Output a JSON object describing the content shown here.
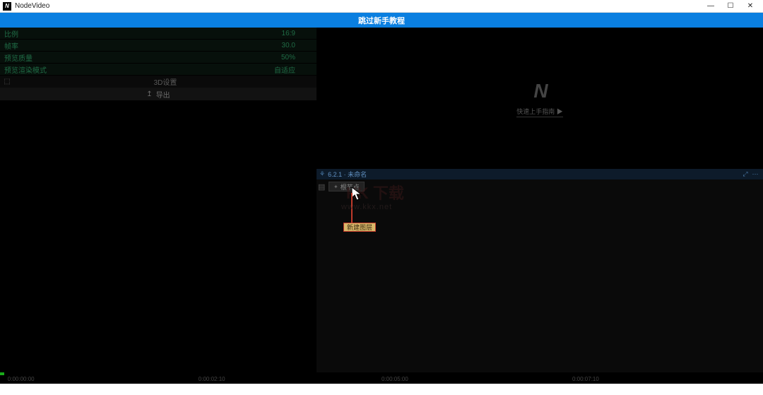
{
  "window": {
    "title": "NodeVideo",
    "logo_glyph": "N"
  },
  "banner": {
    "text": "跳过新手教程"
  },
  "props": {
    "rows": [
      {
        "label": "比例",
        "value": "16:9"
      },
      {
        "label": "帧率",
        "value": "30.0"
      },
      {
        "label": "预览质量",
        "value": "50%"
      },
      {
        "label": "预览渲染模式",
        "value": "自适应"
      }
    ],
    "threed_label": "3D设置",
    "export_label": "导出"
  },
  "preview": {
    "brand_glyph": "N",
    "guide_text": "快速上手指南 ▶"
  },
  "node_panel": {
    "title": "6.2.1 · 未命名",
    "root_node": "根节点",
    "new_layer": "新建图层"
  },
  "watermark": {
    "brand": "KK 下载",
    "url": "www.kkx.net"
  },
  "timeline": {
    "ticks": [
      {
        "pos": 0,
        "label": "0:00:00:00"
      },
      {
        "pos": 25,
        "label": "0:00:02:10"
      },
      {
        "pos": 50,
        "label": "0:00:05:00"
      },
      {
        "pos": 75,
        "label": "0:00:07:10"
      }
    ]
  }
}
